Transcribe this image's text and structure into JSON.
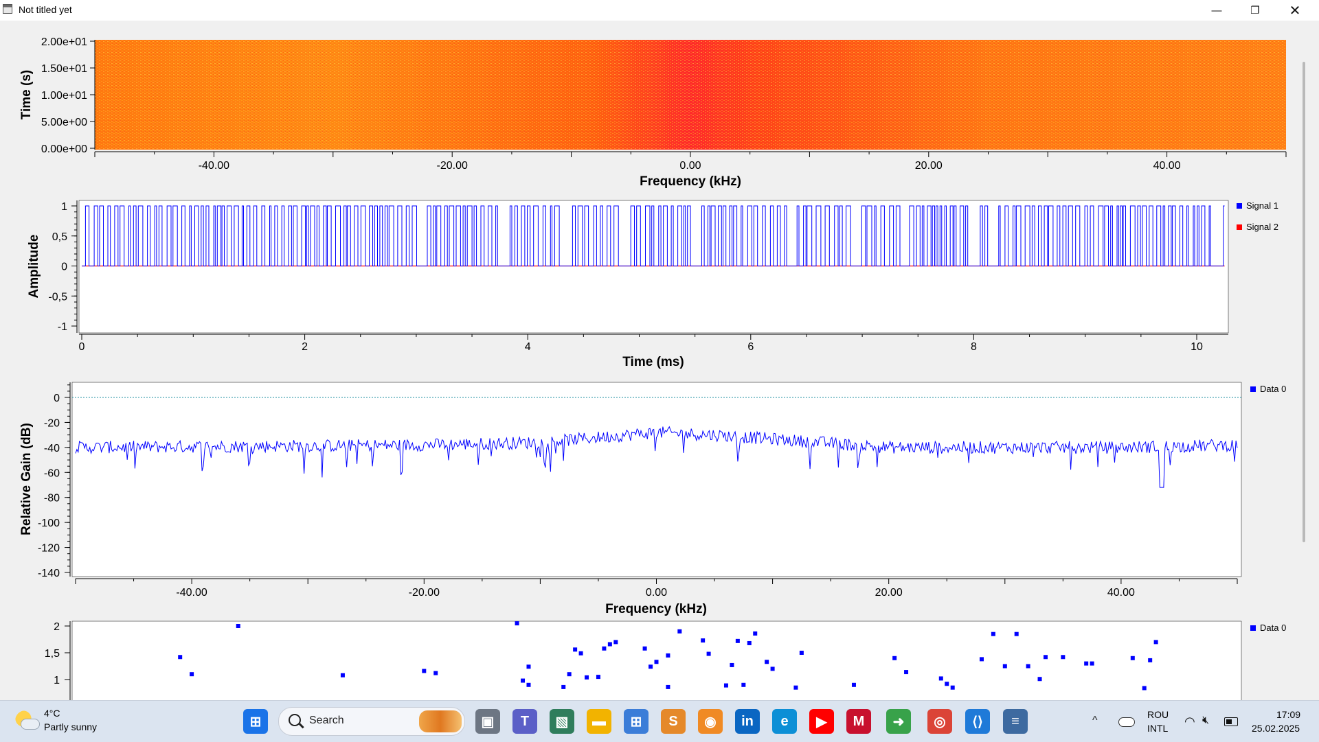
{
  "window": {
    "title": "Not titled yet",
    "min_glyph": "—",
    "max_glyph": "❐",
    "close_glyph": "✕"
  },
  "waterfall": {
    "ylabel": "Time (s)",
    "xlabel": "Frequency (kHz)",
    "yticks": [
      "2.00e+01",
      "1.50e+01",
      "1.00e+01",
      "5.00e+00",
      "0.00e+00"
    ],
    "xticks": [
      "-40.00",
      "-20.00",
      "0.00",
      "20.00",
      "40.00"
    ]
  },
  "chart_data": [
    {
      "type": "heatmap",
      "xlabel": "Frequency (kHz)",
      "ylabel": "Time (s)",
      "xlim": [
        -50,
        50
      ],
      "ylim": [
        0,
        20
      ],
      "ytick_labels": [
        "2.00e+01",
        "1.50e+01",
        "1.00e+01",
        "5.00e+00",
        "0.00e+00"
      ],
      "xtick_labels": [
        "-40.00",
        "-20.00",
        "0.00",
        "20.00",
        "40.00"
      ],
      "colormap": [
        "#ffb000",
        "#ff6a00",
        "#ff2a20"
      ]
    },
    {
      "type": "line",
      "xlabel": "Time (ms)",
      "ylabel": "Amplitude",
      "xlim": [
        0,
        10.25
      ],
      "ylim": [
        -1,
        1
      ],
      "ytick_labels": [
        "1",
        "0,5",
        "0",
        "-0,5",
        "-1"
      ],
      "xtick_labels": [
        "0",
        "2",
        "4",
        "6",
        "8",
        "10"
      ],
      "series": [
        {
          "name": "Signal 1",
          "color": "#0000ff",
          "shape": "binary 0/1 square wave"
        },
        {
          "name": "Signal 2",
          "color": "#ff0000",
          "values_constant": 0
        }
      ],
      "legend": "top-right"
    },
    {
      "type": "line",
      "xlabel": "Frequency (kHz)",
      "ylabel": "Relative Gain (dB)",
      "xlim": [
        -50,
        50
      ],
      "ylim": [
        -140,
        10
      ],
      "ytick_labels": [
        "0",
        "-20",
        "-40",
        "-60",
        "-80",
        "-100",
        "-120",
        "-140"
      ],
      "xtick_labels": [
        "-40.00",
        "-20.00",
        "0.00",
        "20.00",
        "40.00"
      ],
      "series": [
        {
          "name": "Data 0",
          "color": "#0000ff",
          "envelope": [
            [
              -50,
              -40
            ],
            [
              -20,
              -38
            ],
            [
              -10,
              -36
            ],
            [
              0,
              -28
            ],
            [
              5,
              -30
            ],
            [
              20,
              -40
            ],
            [
              40,
              -40
            ],
            [
              50,
              -38
            ]
          ]
        }
      ],
      "reference_line": 0,
      "legend": "top-right"
    },
    {
      "type": "scatter",
      "ylim_visible": [
        0.8,
        2
      ],
      "ytick_labels": [
        "2",
        "1,5",
        "1"
      ],
      "series": [
        {
          "name": "Data 0",
          "color": "#0000ff",
          "points": [
            [
              0.09,
              1.42
            ],
            [
              0.1,
              1.1
            ],
            [
              0.14,
              2
            ],
            [
              0.23,
              1.08
            ],
            [
              0.3,
              1.16
            ],
            [
              0.31,
              1.12
            ],
            [
              0.38,
              2.05
            ],
            [
              0.385,
              0.98
            ],
            [
              0.39,
              1.24
            ],
            [
              0.39,
              0.9
            ],
            [
              0.42,
              0.86
            ],
            [
              0.425,
              1.1
            ],
            [
              0.43,
              1.56
            ],
            [
              0.435,
              1.49
            ],
            [
              0.44,
              1.04
            ],
            [
              0.45,
              1.05
            ],
            [
              0.455,
              1.58
            ],
            [
              0.46,
              1.66
            ],
            [
              0.465,
              1.7
            ],
            [
              0.49,
              1.58
            ],
            [
              0.495,
              1.24
            ],
            [
              0.5,
              1.33
            ],
            [
              0.51,
              1.45
            ],
            [
              0.51,
              0.86
            ],
            [
              0.52,
              1.9
            ],
            [
              0.54,
              1.73
            ],
            [
              0.545,
              1.48
            ],
            [
              0.56,
              0.89
            ],
            [
              0.565,
              1.27
            ],
            [
              0.57,
              1.72
            ],
            [
              0.575,
              0.9
            ],
            [
              0.58,
              1.68
            ],
            [
              0.585,
              1.86
            ],
            [
              0.595,
              1.33
            ],
            [
              0.6,
              1.2
            ],
            [
              0.62,
              0.85
            ],
            [
              0.625,
              1.5
            ],
            [
              0.67,
              0.9
            ],
            [
              0.705,
              1.4
            ],
            [
              0.715,
              1.14
            ],
            [
              0.745,
              1.02
            ],
            [
              0.75,
              0.92
            ],
            [
              0.755,
              0.85
            ],
            [
              0.78,
              1.38
            ],
            [
              0.79,
              1.85
            ],
            [
              0.8,
              1.25
            ],
            [
              0.81,
              1.85
            ],
            [
              0.82,
              1.25
            ],
            [
              0.83,
              1.01
            ],
            [
              0.835,
              1.42
            ],
            [
              0.85,
              1.42
            ],
            [
              0.87,
              1.3
            ],
            [
              0.875,
              1.3
            ],
            [
              0.91,
              1.4
            ],
            [
              0.92,
              0.84
            ],
            [
              0.925,
              1.36
            ],
            [
              0.93,
              1.7
            ]
          ]
        }
      ],
      "legend": "top-right"
    }
  ],
  "time_plot": {
    "ylabel": "Amplitude",
    "xlabel": "Time (ms)",
    "yticks": [
      "1",
      "0,5",
      "0",
      "-0,5",
      "-1"
    ],
    "xticks": [
      "0",
      "2",
      "4",
      "6",
      "8",
      "10"
    ],
    "legend": [
      {
        "label": "Signal 1",
        "color": "#0000ff"
      },
      {
        "label": "Signal 2",
        "color": "#ff0000"
      }
    ]
  },
  "freq_plot": {
    "ylabel": "Relative Gain (dB)",
    "xlabel": "Frequency (kHz)",
    "yticks": [
      "0",
      "-20",
      "-40",
      "-60",
      "-80",
      "-100",
      "-120",
      "-140"
    ],
    "xticks": [
      "-40.00",
      "-20.00",
      "0.00",
      "20.00",
      "40.00"
    ],
    "legend": [
      {
        "label": "Data 0",
        "color": "#0000ff"
      }
    ]
  },
  "const_plot": {
    "yticks": [
      "2",
      "1,5",
      "1"
    ],
    "legend": [
      {
        "label": "Data 0",
        "color": "#0000ff"
      }
    ]
  },
  "taskbar": {
    "weather_temp": "4°C",
    "weather_desc": "Partly sunny",
    "search_label": "Search",
    "lang_line1": "ROU",
    "lang_line2": "INTL",
    "time": "17:09",
    "date": "25.02.2025",
    "apps": [
      {
        "name": "start",
        "glyph": "⊞",
        "bg": "#1a73e8"
      },
      {
        "name": "task-view",
        "glyph": "▣",
        "bg": "#6d7683"
      },
      {
        "name": "teams",
        "glyph": "T",
        "bg": "#5b5fc7"
      },
      {
        "name": "photos",
        "glyph": "▧",
        "bg": "#2f7d5c"
      },
      {
        "name": "file-explorer",
        "glyph": "▬",
        "bg": "#f2b300"
      },
      {
        "name": "ms-store",
        "glyph": "⊞",
        "bg": "#3b7dd8"
      },
      {
        "name": "sublime",
        "glyph": "S",
        "bg": "#e5892a"
      },
      {
        "name": "brave",
        "glyph": "◉",
        "bg": "#f08a24"
      },
      {
        "name": "linkedin",
        "glyph": "in",
        "bg": "#0a66c2"
      },
      {
        "name": "edge",
        "glyph": "e",
        "bg": "#0c8fd6"
      },
      {
        "name": "youtube",
        "glyph": "▶",
        "bg": "#ff0000"
      },
      {
        "name": "mcafee",
        "glyph": "M",
        "bg": "#c8102e"
      },
      {
        "name": "gnuradio",
        "glyph": "➜",
        "bg": "#38a24a"
      },
      {
        "name": "chrome",
        "glyph": "◎",
        "bg": "#db4437"
      },
      {
        "name": "vscode",
        "glyph": "⟨⟩",
        "bg": "#1f7ad8"
      },
      {
        "name": "python-app",
        "glyph": "≡",
        "bg": "#3d6aa0"
      }
    ]
  }
}
